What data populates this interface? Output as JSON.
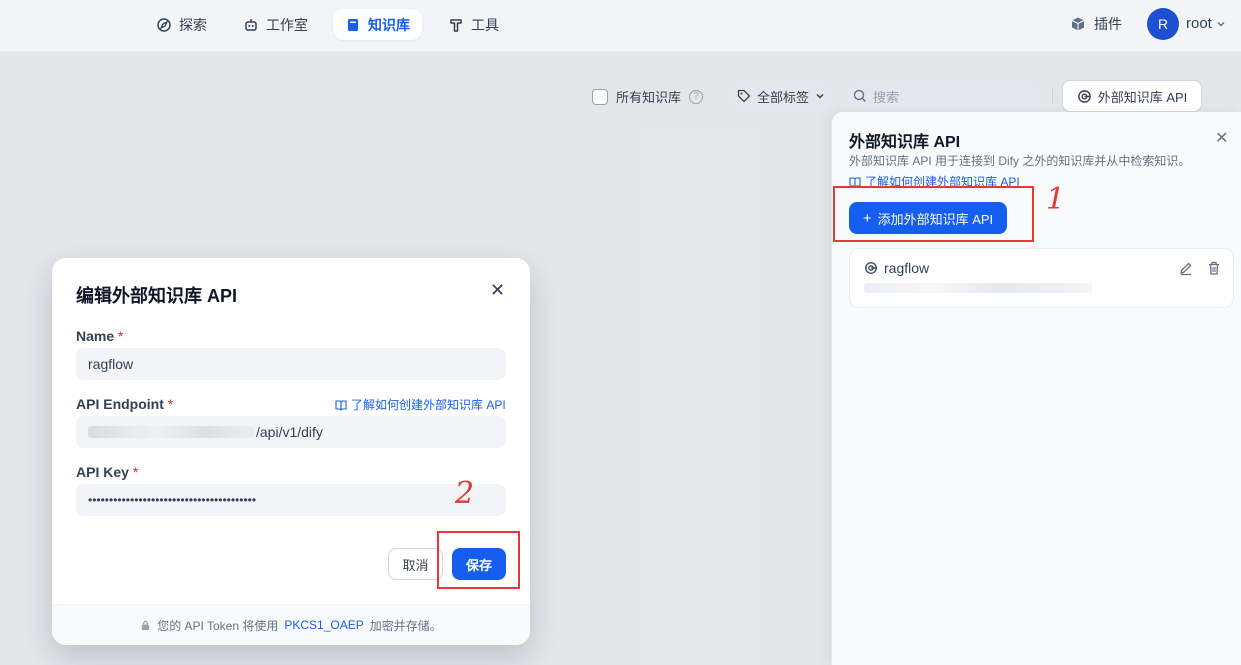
{
  "nav": {
    "items": [
      {
        "label": "探索",
        "icon": "compass-icon"
      },
      {
        "label": "工作室",
        "icon": "robot-icon"
      },
      {
        "label": "知识库",
        "icon": "book-icon",
        "active": true
      },
      {
        "label": "工具",
        "icon": "hammer-icon"
      }
    ],
    "plugins_label": "插件",
    "avatar_letter": "R",
    "username": "root"
  },
  "toolbar": {
    "all_kb_label": "所有知识库",
    "help_glyph": "?",
    "tags_label": "全部标签",
    "search_placeholder": "搜索",
    "external_api_label": "外部知识库 API"
  },
  "panel": {
    "title": "外部知识库 API",
    "description": "外部知识库 API 用于连接到 Dify 之外的知识库并从中检索知识。",
    "link": "了解如何创建外部知识库 API",
    "add_button": "添加外部知识库 API",
    "apis": [
      {
        "name": "ragflow"
      }
    ]
  },
  "modal": {
    "title": "编辑外部知识库 API",
    "name_label": "Name",
    "name_value": "ragflow",
    "endpoint_label": "API Endpoint",
    "endpoint_suffix": "/api/v1/dify",
    "endpoint_help_link": "了解如何创建外部知识库 API",
    "key_label": "API Key",
    "key_value": "••••••••••••••••••••••••••••••••••••••••",
    "required_mark": "*",
    "cancel_label": "取消",
    "save_label": "保存",
    "footer_prefix": "您的 API Token 将使用",
    "footer_algo": "PKCS1_OAEP",
    "footer_suffix": "加密并存储。"
  },
  "annotations": {
    "step1": "1",
    "step2": "2",
    "color": "#e53935"
  },
  "colors": {
    "primary": "#155eef",
    "danger": "#d92d20"
  }
}
